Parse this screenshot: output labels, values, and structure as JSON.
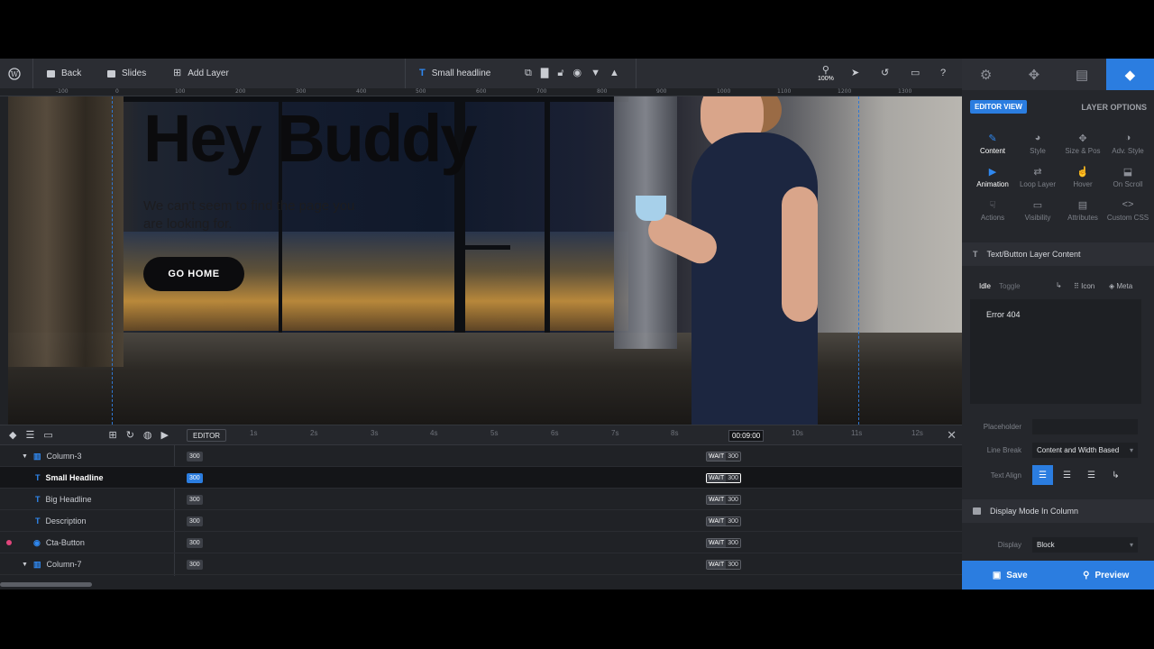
{
  "toolbar": {
    "back": "Back",
    "slides": "Slides",
    "add_layer": "Add Layer",
    "current_layer": "Small headline",
    "zoom": "100%"
  },
  "ruler": [
    "-100",
    "0",
    "100",
    "200",
    "300",
    "400",
    "500",
    "600",
    "700",
    "800",
    "900",
    "1000",
    "1100",
    "1200",
    "1300"
  ],
  "canvas": {
    "title": "Hey Buddy",
    "description": "We can't seem to find the page you are looking for.",
    "button": "GO HOME"
  },
  "timeline": {
    "editor_label": "EDITOR",
    "ticks": [
      "1s",
      "2s",
      "3s",
      "4s",
      "5s",
      "6s",
      "7s",
      "8s",
      "10s",
      "11s",
      "12s"
    ],
    "current_time": "00:09:00",
    "rows": [
      {
        "name": "Column-3",
        "start": "300",
        "wait": "WAIT",
        "end": "300"
      },
      {
        "name": "Small Headline",
        "start": "300",
        "wait": "WAIT",
        "end": "300"
      },
      {
        "name": "Big Headline",
        "start": "300",
        "wait": "WAIT",
        "end": "300"
      },
      {
        "name": "Description",
        "start": "300",
        "wait": "WAIT",
        "end": "300"
      },
      {
        "name": "Cta-Button",
        "start": "300",
        "wait": "WAIT",
        "end": "300"
      },
      {
        "name": "Column-7",
        "start": "300",
        "wait": "WAIT",
        "end": "300"
      }
    ]
  },
  "panel": {
    "editor_view": "EDITOR VIEW",
    "layer_options": "LAYER OPTIONS",
    "grid": [
      {
        "label": "Content",
        "icon": "pencil-icon"
      },
      {
        "label": "Style",
        "icon": "palette-icon"
      },
      {
        "label": "Size & Pos",
        "icon": "move-icon"
      },
      {
        "label": "Adv. Style",
        "icon": "drop-icon"
      },
      {
        "label": "Animation",
        "icon": "play-icon"
      },
      {
        "label": "Loop Layer",
        "icon": "loop-icon"
      },
      {
        "label": "Hover",
        "icon": "hover-icon"
      },
      {
        "label": "On Scroll",
        "icon": "scroll-icon"
      },
      {
        "label": "Actions",
        "icon": "actions-icon"
      },
      {
        "label": "Visibility",
        "icon": "visibility-icon"
      },
      {
        "label": "Attributes",
        "icon": "attributes-icon"
      },
      {
        "label": "Custom CSS",
        "icon": "code-icon"
      }
    ],
    "section_content": "Text/Button Layer Content",
    "tab_idle": "Idle",
    "tab_toggle": "Toggle",
    "icon_label": "Icon",
    "meta_label": "Meta",
    "content_text": "Error 404",
    "placeholder_label": "Placeholder",
    "placeholder_value": "",
    "line_break_label": "Line Break",
    "line_break_value": "Content and Width Based",
    "text_align_label": "Text Align",
    "section_display": "Display Mode In Column",
    "display_label": "Display",
    "display_value": "Block",
    "save": "Save",
    "preview": "Preview"
  },
  "colors": {
    "accent": "#2b7de0",
    "panel": "#25272c",
    "toolbar": "#2b2d33"
  }
}
